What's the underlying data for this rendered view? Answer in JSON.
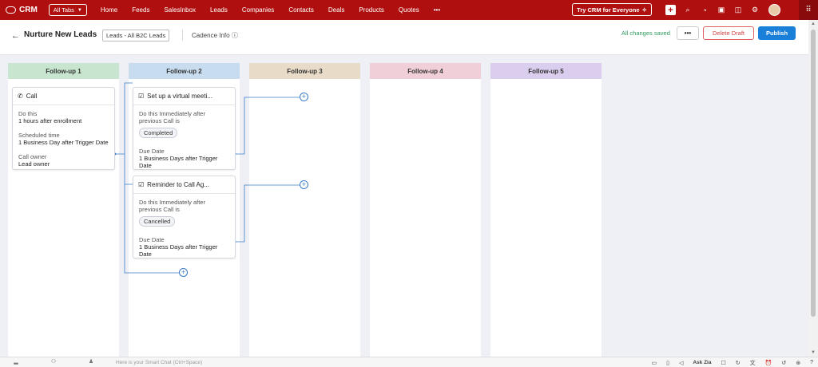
{
  "app": {
    "name": "CRM",
    "all_tabs_label": "All Tabs",
    "nav": [
      "Home",
      "Feeds",
      "SalesInbox",
      "Leads",
      "Companies",
      "Contacts",
      "Deals",
      "Products",
      "Quotes",
      "•••"
    ],
    "try_label": "Try CRM for Everyone"
  },
  "header": {
    "back_arrow": "←",
    "title": "Nurture New Leads",
    "view_tag": "Leads - All B2C Leads",
    "cadence_info": "Cadence Info ⓘ",
    "saved_status": "All changes saved",
    "more_label": "•••",
    "delete_label": "Delete Draft",
    "publish_label": "Publish"
  },
  "columns": [
    {
      "title": "Follow-up 1"
    },
    {
      "title": "Follow-up 2"
    },
    {
      "title": "Follow-up 3"
    },
    {
      "title": "Follow-up 4"
    },
    {
      "title": "Follow-up 5"
    }
  ],
  "call_card": {
    "title": "Call",
    "do_this_label": "Do this",
    "do_this_value": "1 hours after enrollment",
    "scheduled_label": "Scheduled time",
    "scheduled_value": "1 Business Day after Trigger Date",
    "owner_label": "Call owner",
    "owner_value": "Lead owner"
  },
  "task_cards": [
    {
      "title": "Set up a virtual meeti...",
      "condition_line1": "Do this Immediately after",
      "condition_line2": "previous Call is",
      "status": "Completed",
      "due_label": "Due Date",
      "due_line1": "1 Business Days after Trigger",
      "due_line2": "Date"
    },
    {
      "title": "Reminder to Call Ag...",
      "condition_line1": "Do this Immediately after",
      "condition_line2": "previous Call is",
      "status": "Cancelled",
      "due_label": "Due Date",
      "due_line1": "1 Business Days after Trigger",
      "due_line2": "Date"
    }
  ],
  "bottom": {
    "smart_chat_placeholder": "Here is your Smart Chat (Ctrl+Space)",
    "ask_zia": "Ask Zia"
  },
  "colors": {
    "topbar": "#b00f0f",
    "publish": "#1a7fd8",
    "connector": "#3b7cc9"
  }
}
